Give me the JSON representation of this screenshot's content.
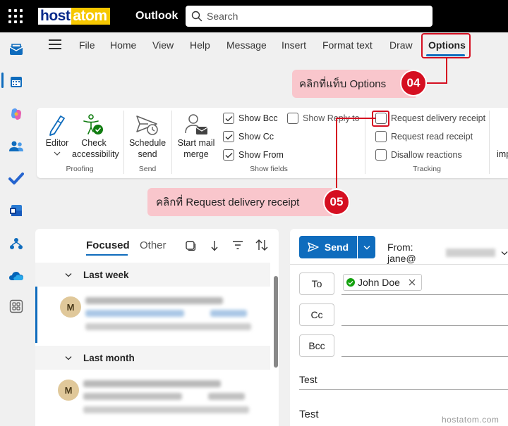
{
  "topbar": {
    "logo_host": "host",
    "logo_atom": "atom",
    "app_name": "Outlook",
    "search_placeholder": "Search"
  },
  "rail": {
    "items": [
      {
        "icon": "mail-icon",
        "color": "#0f6cbd"
      },
      {
        "icon": "calendar-icon",
        "color": "#0f6cbd"
      },
      {
        "icon": "copilot-icon",
        "color": "#9b4dca"
      },
      {
        "icon": "people-icon",
        "color": "#0f6cbd"
      },
      {
        "icon": "todo-icon",
        "color": "#2564cf"
      },
      {
        "icon": "word-icon",
        "color": "#185abd"
      },
      {
        "icon": "org-icon",
        "color": "#0f6cbd"
      },
      {
        "icon": "onedrive-icon",
        "color": "#0364b8"
      },
      {
        "icon": "apps-icon",
        "color": "#616161"
      }
    ]
  },
  "menu": {
    "tabs": [
      "File",
      "Home",
      "View",
      "Help",
      "Message",
      "Insert",
      "Format text",
      "Draw",
      "Options"
    ],
    "active": "Options"
  },
  "callouts": {
    "step4_text": "คลิกที่แท็บ Options",
    "step4_badge": "04",
    "step5_text": "คลิกที่ Request delivery receipt",
    "step5_badge": "05"
  },
  "ribbon": {
    "editor_label": "Editor",
    "check_label_1": "Check",
    "check_label_2": "accessibility",
    "proofing_group": "Proofing",
    "schedule_label_1": "Schedule",
    "schedule_label_2": "send",
    "send_group": "Send",
    "merge_label_1": "Start mail",
    "merge_label_2": "merge",
    "show_bcc": "Show Bcc",
    "show_cc": "Show Cc",
    "show_from": "Show From",
    "show_reply_to": "Show Reply to",
    "show_fields_group": "Show fields",
    "request_delivery": "Request delivery receipt",
    "request_read": "Request read receipt",
    "disallow_reactions": "Disallow reactions",
    "tracking_group": "Tracking",
    "truncated_label": "imp"
  },
  "list": {
    "focused": "Focused",
    "other": "Other",
    "section_1": "Last week",
    "section_2": "Last month",
    "avatar_initial": "M"
  },
  "compose": {
    "send_label": "Send",
    "from_label": "From: jane@",
    "to_label": "To",
    "cc_label": "Cc",
    "bcc_label": "Bcc",
    "recipient": "John Doe",
    "subject": "Test",
    "body": "Test"
  },
  "watermark": "hostatom.com",
  "colors": {
    "accent": "#0f6cbd",
    "highlight": "#d50f21",
    "callout_bg": "#f9c6cc"
  }
}
